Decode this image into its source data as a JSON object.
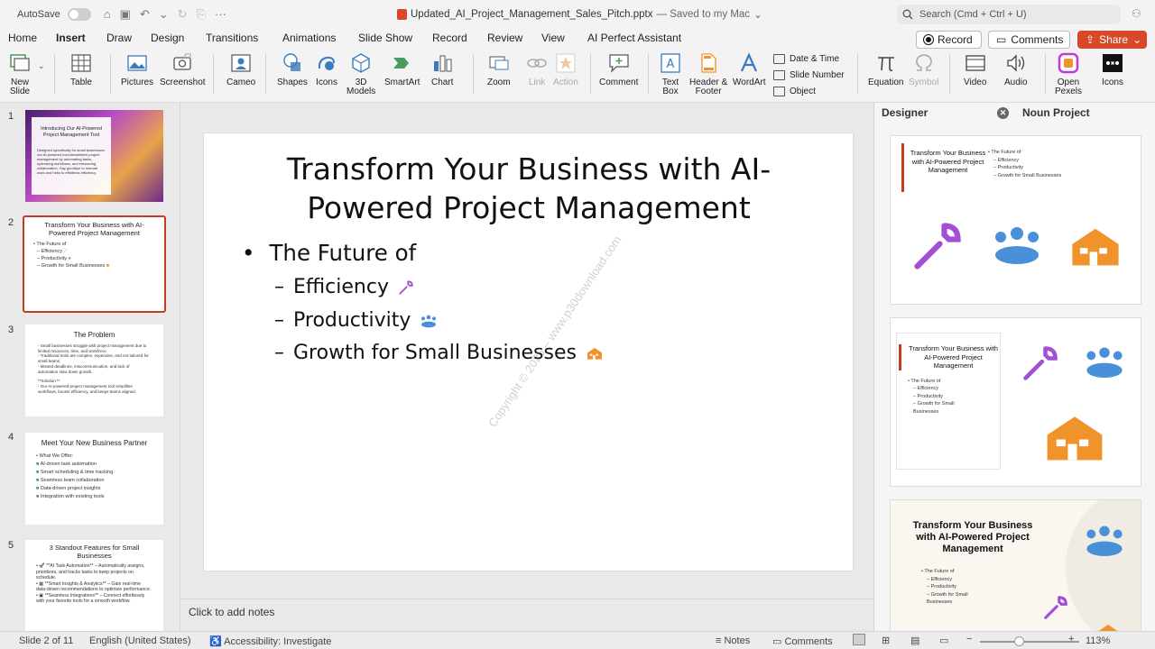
{
  "titlebar": {
    "autosave_label": "AutoSave",
    "doc_name": "Updated_AI_Project_Management_Sales_Pitch.pptx",
    "saved_status": "— Saved to my Mac",
    "search_placeholder": "Search (Cmd + Ctrl + U)"
  },
  "ribbon": {
    "tabs": [
      "Home",
      "Insert",
      "Draw",
      "Design",
      "Transitions",
      "Animations",
      "Slide Show",
      "Record",
      "Review",
      "View",
      "AI Perfect Assistant"
    ],
    "active_tab": "Insert",
    "record_label": "Record",
    "comments_label": "Comments",
    "share_label": "Share",
    "tools": {
      "new_slide": [
        "New",
        "Slide"
      ],
      "table": "Table",
      "pictures": "Pictures",
      "screenshot": "Screenshot",
      "cameo": "Cameo",
      "shapes": "Shapes",
      "icons": "Icons",
      "models_3d": [
        "3D",
        "Models"
      ],
      "smartart": "SmartArt",
      "chart": "Chart",
      "zoom": "Zoom",
      "link": "Link",
      "action": "Action",
      "comment": "Comment",
      "text_box": [
        "Text",
        "Box"
      ],
      "header_footer": [
        "Header &",
        "Footer"
      ],
      "wordart": "WordArt",
      "date_time": "Date & Time",
      "slide_number": "Slide Number",
      "object": "Object",
      "equation": "Equation",
      "symbol": "Symbol",
      "video": "Video",
      "audio": "Audio",
      "open_pexels": [
        "Open",
        "Pexels"
      ],
      "icons2": "Icons"
    }
  },
  "thumbnails": [
    {
      "num": "1",
      "title": "Introducing Our AI-Powered Project Management Tool",
      "body": "Designed specifically for small businesses, our AI-powered tool streamlines project management by automating tasks, optimizing workflows, and enhancing collaboration. Say goodbye to manual work and hello to effortless efficiency."
    },
    {
      "num": "2",
      "title": "Transform Your Business with AI-Powered Project Management",
      "lines": [
        "• The Future of",
        "– Efficiency",
        "– Productivity",
        "– Growth for Small Businesses"
      ]
    },
    {
      "num": "3",
      "title": "The Problem",
      "lines": [
        "- Small businesses struggle with project management due to limited resources, time, and workforce.",
        "- Traditional tools are complex, expensive, and not tailored for small teams.",
        "- Missed deadlines, miscommunication, and lack of automation slow down growth.",
        "",
        "**Solution:**",
        "- Our AI-powered project management tool simplifies workflows, boosts efficiency, and keeps teams aligned."
      ]
    },
    {
      "num": "4",
      "title": "Meet Your New Business Partner",
      "lines": [
        "• What We Offer:",
        "AI-driven task automation",
        "Smart scheduling & time tracking",
        "Seamless team collaboration",
        "Data-driven project insights",
        "Integration with existing tools"
      ]
    },
    {
      "num": "5",
      "title": "3 Standout Features for Small Businesses",
      "lines": [
        "**AI Task Automation** – Automatically assigns, prioritizes, and tracks tasks to keep projects on schedule.",
        "**Smart Insights & Analytics** – Gain real-time data-driven recommendations to optimize performance.",
        "**Seamless Integrations** – Connect effortlessly with your favorite tools for a smooth workflow."
      ]
    }
  ],
  "slide": {
    "title": "Transform Your Business with AI-Powered Project Management",
    "bullet": "The Future of",
    "subs": [
      "Efficiency",
      "Productivity",
      "Growth for Small Businesses"
    ],
    "watermark": "Copyright © 2025 – www.p30download.com",
    "notes_placeholder": "Click to add notes"
  },
  "designer": {
    "tab1": "Designer",
    "tab2": "Noun Project",
    "card_title": "Transform Your Business with AI-Powered Project Management",
    "card_lines": [
      "• The Future of",
      "– Efficiency",
      "– Productivity",
      "– Growth for Small Businesses"
    ]
  },
  "status": {
    "slide_info": "Slide 2 of 11",
    "language": "English (United States)",
    "accessibility": "Accessibility: Investigate",
    "notes": "Notes",
    "comments": "Comments",
    "zoom": "113%"
  },
  "colors": {
    "accent": "#c43e1c",
    "share": "#d8492a",
    "wrench": "#a24fd6",
    "people": "#4a90d9",
    "house": "#f0932b"
  }
}
